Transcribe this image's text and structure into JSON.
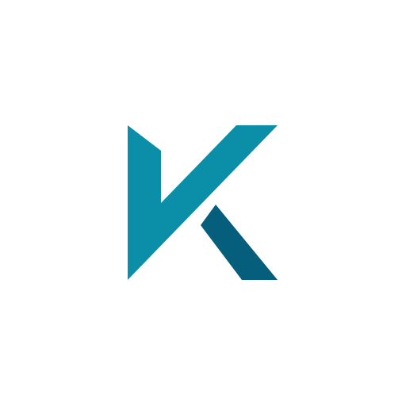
{
  "logo": {
    "letter": "K",
    "icon": "k-logo-icon",
    "colors": {
      "primary": "#0B8EA8",
      "secondary": "#055E7C",
      "background": "#FFFFFF"
    }
  }
}
